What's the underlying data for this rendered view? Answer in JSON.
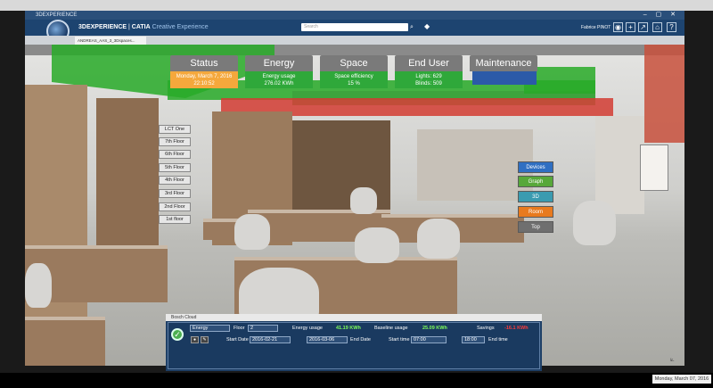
{
  "window": {
    "title": "3DEXPERIENCE"
  },
  "header": {
    "brand_bold": "3DEXPERIENCE",
    "brand_app": "CATIA",
    "brand_sub": "Creative Experience",
    "search_placeholder": "Search",
    "user": "Fabrice PINOT"
  },
  "doc_tab": {
    "label": "ANDREAS_AAS_3_3Dspaces..."
  },
  "kpis": [
    {
      "label": "Status",
      "line1": "Monday, March 7, 2016",
      "line2": "22:10:52",
      "color": "#f5a83c"
    },
    {
      "label": "Energy",
      "line1": "Energy usage",
      "line2": "276.02 KWh",
      "color": "#2fa83a"
    },
    {
      "label": "Space",
      "line1": "Space efficiency",
      "line2": "15 %",
      "color": "#2fa83a"
    },
    {
      "label": "End User",
      "line1": "Lights: 629",
      "line2": "Blinds: 509",
      "color": "#2fa83a"
    },
    {
      "label": "Maintenance",
      "line1": "",
      "line2": "",
      "color": "#2b5aa8"
    }
  ],
  "floors": [
    "LCT One",
    "7th Floor",
    "6th Floor",
    "5th Floor",
    "4th Floor",
    "3rd Floor",
    "2nd Floor",
    "1st floor"
  ],
  "view_buttons": [
    {
      "label": "Devices",
      "color": "#2f6fc2"
    },
    {
      "label": "Graph",
      "color": "#57a83a"
    },
    {
      "label": "3D",
      "color": "#3a9bb0"
    },
    {
      "label": "Room",
      "color": "#e87a1e"
    },
    {
      "label": "Top",
      "color": "#6f6f6f"
    }
  ],
  "panel": {
    "title": "Bosch Cloud",
    "mode": "Energy",
    "floor_label": "Floor",
    "floor_value": "2",
    "energy_label": "Energy usage",
    "energy_value": "41.19 KWh",
    "baseline_label": "Baseline usage",
    "baseline_value": "25.09 KWh",
    "savings_label": "Savings",
    "savings_value": "-16.1 KWh",
    "start_date_label": "Start Date",
    "start_date_value": "2016-02-21",
    "end_date_value": "2016-03-06",
    "end_date_label": "End Date",
    "start_time_label": "Start time",
    "start_time_value": "07:00",
    "end_time_value": "18:00",
    "end_time_label": "End time"
  },
  "taskbar": {
    "date": "Monday, March 07, 2016"
  }
}
